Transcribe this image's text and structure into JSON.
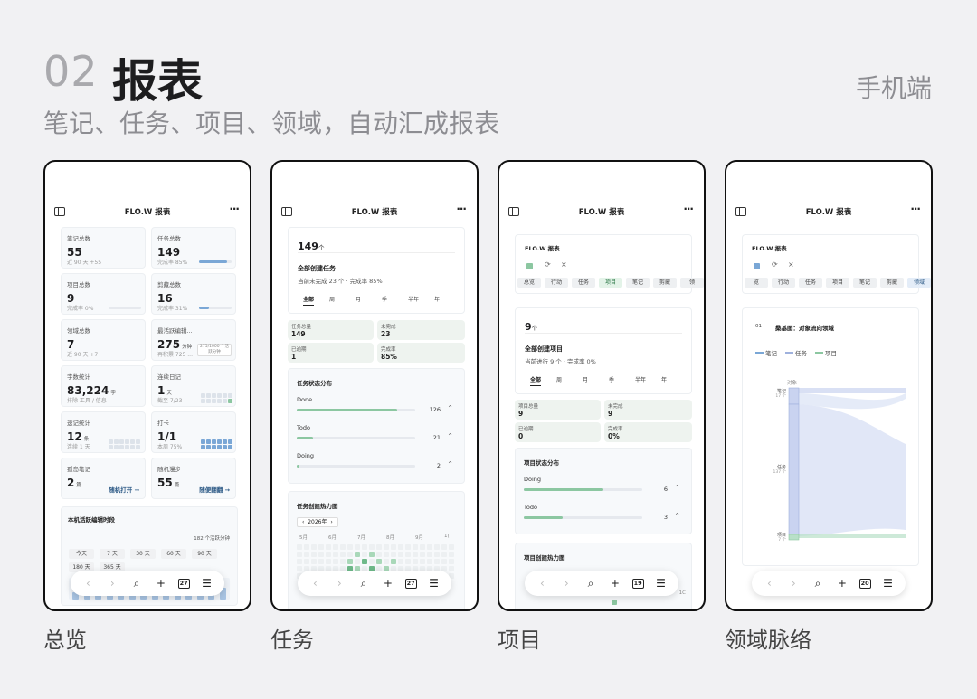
{
  "header": {
    "number": "02",
    "title": "报表",
    "subtitle": "笔记、任务、项目、领域，自动汇成报表",
    "platform": "手机端"
  },
  "common": {
    "app_title": "FLO.W 报表",
    "more": "···",
    "nav": {
      "back": "‹",
      "forward": "›",
      "search": "⌕",
      "add": "+",
      "menu": "☰"
    }
  },
  "phones": [
    {
      "caption": "总览",
      "date_badge": "27",
      "stats": [
        {
          "label": "笔记总数",
          "value": "55",
          "sub": "近 90 天 +55",
          "progress": 0
        },
        {
          "label": "任务总数",
          "value": "149",
          "sub": "完成率 85%",
          "progress": 0.85
        },
        {
          "label": "项目总数",
          "value": "9",
          "sub": "完成率 0%",
          "progress": 0
        },
        {
          "label": "剪藏总数",
          "value": "16",
          "sub": "完成率 31%",
          "progress": 0.31
        },
        {
          "label": "领域总数",
          "value": "7",
          "sub": "近 90 天 +7",
          "progress": 0
        },
        {
          "label": "最活跃编辑...",
          "value": "275",
          "unit": "分钟",
          "sub": "再积累 725 ...",
          "extra": "275/1000 个活跃分钟"
        },
        {
          "label": "字数统计",
          "value": "83,224",
          "unit": "字",
          "sub": "排除 工具 / 信息"
        },
        {
          "label": "连续日记",
          "value": "1",
          "unit": "天",
          "sub": "截至 7/23"
        },
        {
          "label": "速记统计",
          "value": "12",
          "unit": "条",
          "sub": "连续 1 天"
        },
        {
          "label": "打卡",
          "value": "1/1",
          "sub": "本周 75%"
        },
        {
          "label": "孤岛笔记",
          "value": "2",
          "unit": "篇",
          "link": "随机打开 →"
        },
        {
          "label": "随机漫步",
          "value": "55",
          "unit": "篇",
          "link": "随便翻翻 →"
        }
      ],
      "active_section": {
        "title": "本机活跃编辑时段",
        "total": "182 个活跃分钟",
        "ranges": [
          "今天",
          "7 天",
          "30 天",
          "60 天",
          "90 天",
          "180 天",
          "365 天"
        ]
      }
    },
    {
      "caption": "任务",
      "date_badge": "27",
      "summary": {
        "count": "149",
        "unit": "个",
        "title": "全部创建任务",
        "desc": "当前未完成 23 个 · 完成率 85%"
      },
      "periods": [
        "全部",
        "周",
        "月",
        "季",
        "半年",
        "年"
      ],
      "metrics": [
        {
          "label": "任务总量",
          "value": "149"
        },
        {
          "label": "未完成",
          "value": "23"
        },
        {
          "label": "已逾期",
          "value": "1"
        },
        {
          "label": "完成率",
          "value": "85%"
        }
      ],
      "distribution": {
        "title": "任务状态分布",
        "items": [
          {
            "name": "Done",
            "count": "126",
            "share": 0.85
          },
          {
            "name": "Todo",
            "count": "21",
            "share": 0.14
          },
          {
            "name": "Doing",
            "count": "2",
            "share": 0.02
          }
        ]
      },
      "heatmap": {
        "title": "任务创建热力图",
        "year": "2026年",
        "months": [
          "5月",
          "6月",
          "7月",
          "8月",
          "9月",
          "1("
        ]
      }
    },
    {
      "caption": "项目",
      "date_badge": "19",
      "report_title": "FLO.W 报表",
      "tabs": [
        "总览",
        "行动",
        "任务",
        "项目",
        "笔记",
        "剪藏",
        "领"
      ],
      "active_tab": "项目",
      "summary": {
        "count": "9",
        "unit": "个",
        "title": "全部创建项目",
        "desc": "当前进行 9 个 · 完成率 0%"
      },
      "periods": [
        "全部",
        "周",
        "月",
        "季",
        "半年",
        "年"
      ],
      "metrics": [
        {
          "label": "项目总量",
          "value": "9"
        },
        {
          "label": "未完成",
          "value": "9"
        },
        {
          "label": "已逾期",
          "value": "0"
        },
        {
          "label": "完成率",
          "value": "0%"
        }
      ],
      "distribution": {
        "title": "项目状态分布",
        "items": [
          {
            "name": "Doing",
            "count": "6",
            "share": 0.67
          },
          {
            "name": "Todo",
            "count": "3",
            "share": 0.33
          }
        ]
      },
      "heatmap": {
        "title": "项目创建热力图",
        "month_edge": "1C"
      }
    },
    {
      "caption": "领域脉络",
      "date_badge": "20",
      "report_title": "FLO.W 报表",
      "tabs": [
        "览",
        "行动",
        "任务",
        "项目",
        "笔记",
        "剪藏",
        "领域"
      ],
      "active_tab": "领域",
      "sankey": {
        "index": "01",
        "title": "桑基图：对象流向领域",
        "legend": [
          "笔记",
          "任务",
          "项目"
        ],
        "head_label": "对象",
        "nodes": [
          {
            "name": "笔记",
            "count": "17 个"
          },
          {
            "name": "任务",
            "count": "137 个"
          },
          {
            "name": "项目",
            "count": "7 个"
          }
        ]
      }
    }
  ],
  "colors": {
    "accent": "#7aa7d6",
    "green": "#8cc7a1",
    "lavender": "#c9d3f0"
  }
}
